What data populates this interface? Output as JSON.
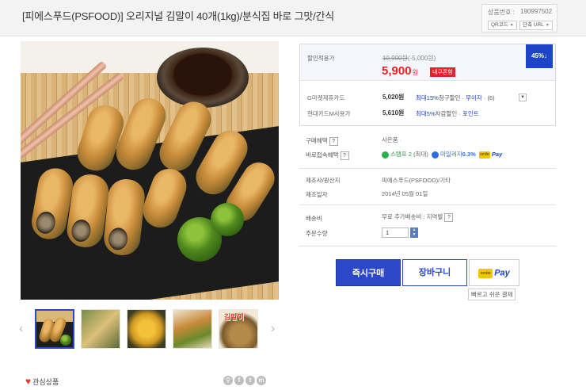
{
  "header": {
    "title": "[피에스푸드(PSFOOD)] 오리지널 김말이 40개(1kg)/분식집 바로 그맛/간식",
    "product_no_label": "상품번호 :",
    "product_no": "190997502",
    "qr_label": "QR코드",
    "short_url_label": "단축 URL"
  },
  "gallery": {
    "thumb5_label": "김말이",
    "favorite_label": "관심상품",
    "sns_icons": [
      "f",
      "t",
      "m"
    ]
  },
  "price": {
    "discount_label": "할인적용가",
    "original_price": "10,900원",
    "discount_amount": "(-5,000원)",
    "final_price": "5,900",
    "won": "원",
    "coupon": "내쿠폰함",
    "discount_badge": "45%↓",
    "card1_label": "G마켓제휴카드",
    "card1_amount": "5,020원",
    "card1_desc_max": "최대15%",
    "card1_desc_rest": "청구할인 ·",
    "card1_interest": "무이자",
    "card1_months": "(6)",
    "card2_label": "현대카드M사용가",
    "card2_amount": "5,610원",
    "card2_desc_max": "최대5%",
    "card2_desc_rest": "차감할인 ·",
    "card2_point": "포인트"
  },
  "benefits": {
    "buy_benefit_label": "구매혜택",
    "buy_benefit_value": "사은품 ·",
    "direct_benefit_label": "바로접속혜택",
    "stamp_label": "스탬프 2",
    "stamp_extra": "(최대)",
    "mileage_label": "마일리지",
    "mileage_value": "0.3%",
    "smilepay": "Pay"
  },
  "info": {
    "maker_label": "제조사/원산지",
    "maker_value": "피에스푸드(PSFOOD)/기타",
    "date_label": "제조일자",
    "date_value": "2014년 05월 01일",
    "shipping_label": "배송비",
    "shipping_value": "무료 추가배송비 : 지역별",
    "qty_label": "주문수량",
    "qty_value": "1"
  },
  "actions": {
    "buy": "즉시구매",
    "cart": "장바구니",
    "pay": "Pay",
    "smile": "smile",
    "tooltip": "빠르고 쉬운 결제"
  },
  "colors": {
    "accent_blue": "#2b48c8",
    "price_red": "#e4222a"
  }
}
